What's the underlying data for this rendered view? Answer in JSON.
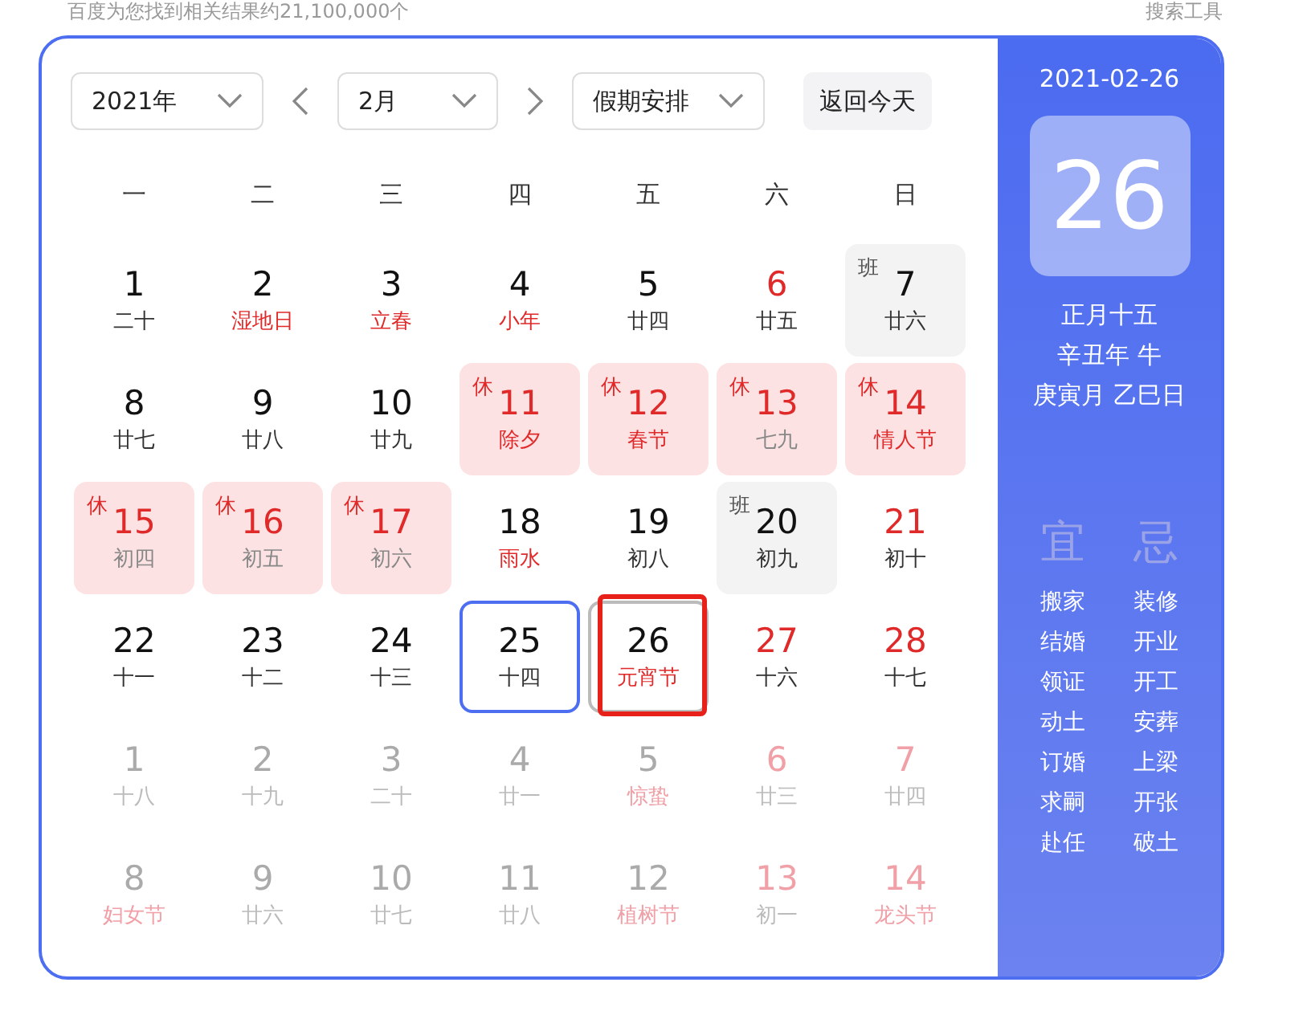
{
  "search_info": {
    "result_count": "百度为您找到相关结果约21,100,000个",
    "tools": "搜索工具"
  },
  "toolbar": {
    "year": "2021年",
    "month": "2月",
    "holiday": "假期安排",
    "today_button": "返回今天"
  },
  "weekdays": [
    "一",
    "二",
    "三",
    "四",
    "五",
    "六",
    "日"
  ],
  "days": [
    {
      "day": "1",
      "lunar": "二十",
      "kind": "normal",
      "weekend": false,
      "festival": false,
      "other_month": false
    },
    {
      "day": "2",
      "lunar": "湿地日",
      "kind": "normal",
      "weekend": false,
      "festival": true,
      "other_month": false
    },
    {
      "day": "3",
      "lunar": "立春",
      "kind": "normal",
      "weekend": false,
      "festival": true,
      "other_month": false
    },
    {
      "day": "4",
      "lunar": "小年",
      "kind": "normal",
      "weekend": false,
      "festival": true,
      "other_month": false
    },
    {
      "day": "5",
      "lunar": "廿四",
      "kind": "normal",
      "weekend": false,
      "festival": false,
      "other_month": false
    },
    {
      "day": "6",
      "lunar": "廿五",
      "kind": "normal",
      "weekend": true,
      "festival": false,
      "other_month": false
    },
    {
      "day": "7",
      "lunar": "廿六",
      "kind": "work",
      "badge": "班",
      "weekend": false,
      "festival": false,
      "other_month": false
    },
    {
      "day": "8",
      "lunar": "廿七",
      "kind": "normal",
      "weekend": false,
      "festival": false,
      "other_month": false
    },
    {
      "day": "9",
      "lunar": "廿八",
      "kind": "normal",
      "weekend": false,
      "festival": false,
      "other_month": false
    },
    {
      "day": "10",
      "lunar": "廿九",
      "kind": "normal",
      "weekend": false,
      "festival": false,
      "other_month": false
    },
    {
      "day": "11",
      "lunar": "除夕",
      "kind": "rest",
      "badge": "休",
      "weekend": true,
      "festival": true,
      "other_month": false
    },
    {
      "day": "12",
      "lunar": "春节",
      "kind": "rest",
      "badge": "休",
      "weekend": true,
      "festival": true,
      "other_month": false
    },
    {
      "day": "13",
      "lunar": "七九",
      "kind": "rest",
      "badge": "休",
      "weekend": true,
      "festival": false,
      "other_month": false
    },
    {
      "day": "14",
      "lunar": "情人节",
      "kind": "rest",
      "badge": "休",
      "weekend": true,
      "festival": true,
      "other_month": false
    },
    {
      "day": "15",
      "lunar": "初四",
      "kind": "rest",
      "badge": "休",
      "weekend": true,
      "festival": false,
      "other_month": false
    },
    {
      "day": "16",
      "lunar": "初五",
      "kind": "rest",
      "badge": "休",
      "weekend": true,
      "festival": false,
      "other_month": false
    },
    {
      "day": "17",
      "lunar": "初六",
      "kind": "rest",
      "badge": "休",
      "weekend": true,
      "festival": false,
      "other_month": false
    },
    {
      "day": "18",
      "lunar": "雨水",
      "kind": "normal",
      "weekend": false,
      "festival": true,
      "other_month": false
    },
    {
      "day": "19",
      "lunar": "初八",
      "kind": "normal",
      "weekend": false,
      "festival": false,
      "other_month": false
    },
    {
      "day": "20",
      "lunar": "初九",
      "kind": "work",
      "badge": "班",
      "weekend": false,
      "festival": false,
      "other_month": false
    },
    {
      "day": "21",
      "lunar": "初十",
      "kind": "normal",
      "weekend": true,
      "festival": false,
      "other_month": false
    },
    {
      "day": "22",
      "lunar": "十一",
      "kind": "normal",
      "weekend": false,
      "festival": false,
      "other_month": false
    },
    {
      "day": "23",
      "lunar": "十二",
      "kind": "normal",
      "weekend": false,
      "festival": false,
      "other_month": false
    },
    {
      "day": "24",
      "lunar": "十三",
      "kind": "normal",
      "weekend": false,
      "festival": false,
      "other_month": false
    },
    {
      "day": "25",
      "lunar": "十四",
      "kind": "today",
      "weekend": false,
      "festival": false,
      "other_month": false
    },
    {
      "day": "26",
      "lunar": "元宵节",
      "kind": "selected",
      "weekend": false,
      "festival": true,
      "other_month": false,
      "annotated": true
    },
    {
      "day": "27",
      "lunar": "十六",
      "kind": "normal",
      "weekend": true,
      "festival": false,
      "other_month": false
    },
    {
      "day": "28",
      "lunar": "十七",
      "kind": "normal",
      "weekend": true,
      "festival": false,
      "other_month": false
    },
    {
      "day": "1",
      "lunar": "十八",
      "kind": "normal",
      "weekend": false,
      "festival": false,
      "other_month": true
    },
    {
      "day": "2",
      "lunar": "十九",
      "kind": "normal",
      "weekend": false,
      "festival": false,
      "other_month": true
    },
    {
      "day": "3",
      "lunar": "二十",
      "kind": "normal",
      "weekend": false,
      "festival": false,
      "other_month": true
    },
    {
      "day": "4",
      "lunar": "廿一",
      "kind": "normal",
      "weekend": false,
      "festival": false,
      "other_month": true
    },
    {
      "day": "5",
      "lunar": "惊蛰",
      "kind": "normal",
      "weekend": false,
      "festival": true,
      "other_month": true
    },
    {
      "day": "6",
      "lunar": "廿三",
      "kind": "normal",
      "weekend": true,
      "festival": false,
      "other_month": true
    },
    {
      "day": "7",
      "lunar": "廿四",
      "kind": "normal",
      "weekend": true,
      "festival": false,
      "other_month": true
    },
    {
      "day": "8",
      "lunar": "妇女节",
      "kind": "normal",
      "weekend": false,
      "festival": true,
      "other_month": true
    },
    {
      "day": "9",
      "lunar": "廿六",
      "kind": "normal",
      "weekend": false,
      "festival": false,
      "other_month": true
    },
    {
      "day": "10",
      "lunar": "廿七",
      "kind": "normal",
      "weekend": false,
      "festival": false,
      "other_month": true
    },
    {
      "day": "11",
      "lunar": "廿八",
      "kind": "normal",
      "weekend": false,
      "festival": false,
      "other_month": true
    },
    {
      "day": "12",
      "lunar": "植树节",
      "kind": "normal",
      "weekend": false,
      "festival": true,
      "other_month": true
    },
    {
      "day": "13",
      "lunar": "初一",
      "kind": "normal",
      "weekend": true,
      "festival": false,
      "other_month": true
    },
    {
      "day": "14",
      "lunar": "龙头节",
      "kind": "normal",
      "weekend": true,
      "festival": true,
      "other_month": true
    }
  ],
  "detail": {
    "date": "2021-02-26",
    "big_day": "26",
    "lunar_lines": [
      "正月十五",
      "辛丑年 牛",
      "庚寅月 乙巳日"
    ],
    "yi_label": "宜",
    "ji_label": "忌",
    "yi": [
      "搬家",
      "结婚",
      "领证",
      "动土",
      "订婚",
      "求嗣",
      "赴任"
    ],
    "ji": [
      "装修",
      "开业",
      "开工",
      "安葬",
      "上梁",
      "开张",
      "破土"
    ]
  }
}
